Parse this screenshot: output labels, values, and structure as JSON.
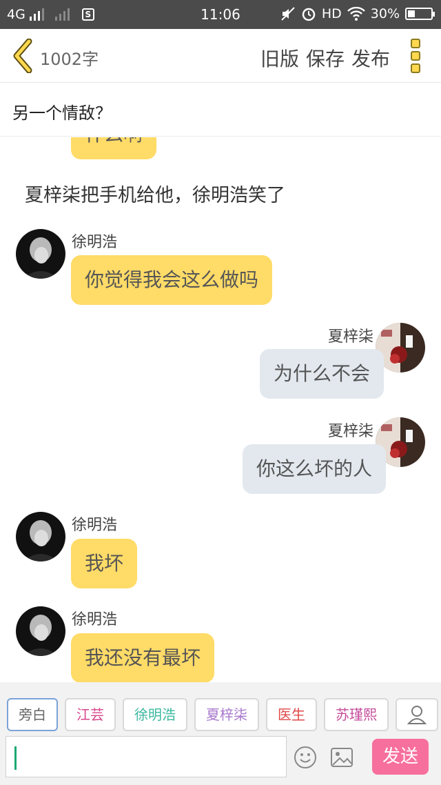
{
  "status_bar": {
    "network": "4G",
    "time": "11:06",
    "hd": "HD",
    "battery": "30%",
    "battery_level": 0.3
  },
  "header": {
    "word_count": "1002字",
    "buttons": [
      "旧版",
      "保存",
      "发布"
    ]
  },
  "title": "另一个情敌？",
  "chat": {
    "top_partial_bubble": "什么啊",
    "narration": "夏梓柒把手机给他，徐明浩笑了",
    "messages": [
      {
        "speaker": "徐明浩",
        "text": "你觉得我会这么做吗",
        "side": "left"
      },
      {
        "speaker": "夏梓柒",
        "text": "为什么不会",
        "side": "right"
      },
      {
        "speaker": "夏梓柒",
        "text": "你这么坏的人",
        "side": "right"
      },
      {
        "speaker": "徐明浩",
        "text": "我坏",
        "side": "left"
      },
      {
        "speaker": "徐明浩",
        "text": "我还没有最坏",
        "side": "left"
      }
    ]
  },
  "characters": [
    {
      "label": "旁白",
      "color": "#666666"
    },
    {
      "label": "江芸",
      "color": "#d9468c"
    },
    {
      "label": "徐明浩",
      "color": "#3cb8a0"
    },
    {
      "label": "夏梓柒",
      "color": "#a878cc"
    },
    {
      "label": "医生",
      "color": "#e04848"
    },
    {
      "label": "苏瑾熙",
      "color": "#c44a9a"
    }
  ],
  "input": {
    "value": ""
  },
  "send_label": "发送"
}
